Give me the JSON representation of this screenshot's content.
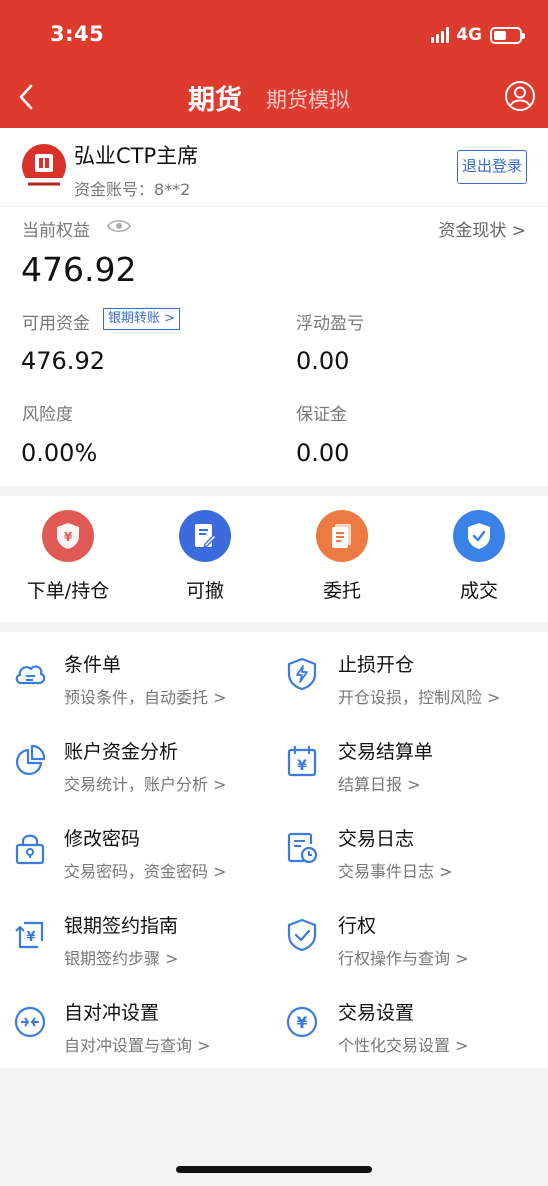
{
  "status_bar": {
    "time": "3:45",
    "network": "4G"
  },
  "nav": {
    "title": "期货",
    "tab": "期货模拟"
  },
  "account": {
    "name": "弘业CTP主席",
    "account_label": "资金账号：",
    "account_number": "8**2",
    "logout_label": "退出登录",
    "equity_label": "当前权益",
    "equity_value": "476.92",
    "fund_status_link": "资金现状 >",
    "available_label": "可用资金",
    "transfer_label": "银期转账 >",
    "available_value": "476.92",
    "floating_pl_label": "浮动盈亏",
    "floating_pl_value": "0.00",
    "risk_label": "风险度",
    "risk_value": "0.00%",
    "margin_label": "保证金",
    "margin_value": "0.00"
  },
  "quick_actions": [
    {
      "label": "下单/持仓",
      "icon": "shield-yen-icon",
      "color": "#e05a55"
    },
    {
      "label": "可撤",
      "icon": "edit-note-icon",
      "color": "#3b6bdc"
    },
    {
      "label": "委托",
      "icon": "document-icon",
      "color": "#ec7a42"
    },
    {
      "label": "成交",
      "icon": "shield-check-icon",
      "color": "#3b82e6"
    }
  ],
  "functions": [
    {
      "title": "条件单",
      "subtitle": "预设条件，自动委托 >",
      "icon": "cloud-list-icon"
    },
    {
      "title": "止损开仓",
      "subtitle": "开仓设损，控制风险 >",
      "icon": "shield-bolt-icon"
    },
    {
      "title": "账户资金分析",
      "subtitle": "交易统计，账户分析 >",
      "icon": "pie-chart-icon"
    },
    {
      "title": "交易结算单",
      "subtitle": "结算日报 >",
      "icon": "calendar-yen-icon"
    },
    {
      "title": "修改密码",
      "subtitle": "交易密码，资金密码 >",
      "icon": "lock-icon"
    },
    {
      "title": "交易日志",
      "subtitle": "交易事件日志 >",
      "icon": "log-clock-icon"
    },
    {
      "title": "银期签约指南",
      "subtitle": "银期签约步骤 >",
      "icon": "yen-transfer-icon"
    },
    {
      "title": "行权",
      "subtitle": "行权操作与查询 >",
      "icon": "shield-check-outline-icon"
    },
    {
      "title": "自对冲设置",
      "subtitle": "自对冲设置与查询 >",
      "icon": "hedge-arrows-icon"
    },
    {
      "title": "交易设置",
      "subtitle": "个性化交易设置 >",
      "icon": "yen-circle-icon"
    }
  ],
  "colors": {
    "brand_red": "#de3a2e",
    "link_blue": "#3b6bc9",
    "icon_blue": "#3d7ae0"
  }
}
